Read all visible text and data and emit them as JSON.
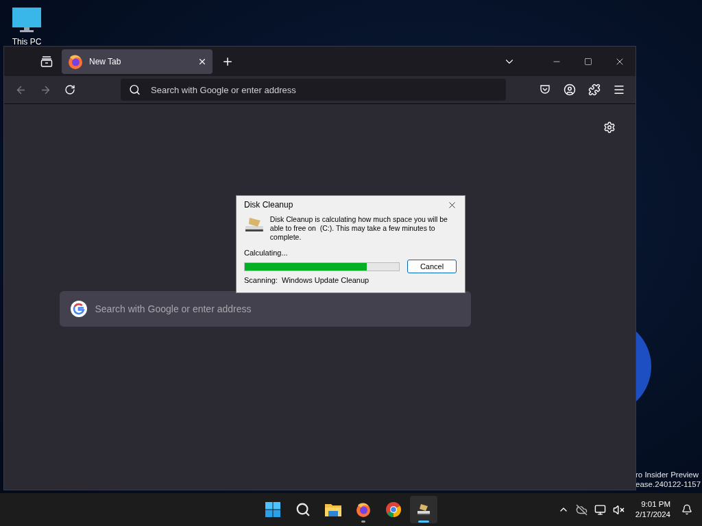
{
  "desktop": {
    "icons": [
      {
        "label": "This PC"
      }
    ],
    "watermark": [
      "ro Insider Preview",
      "ease.240122-1157"
    ]
  },
  "browser": {
    "tabs": [
      {
        "label": "New Tab",
        "selected": true
      }
    ],
    "address_bar": {
      "placeholder": "Search with Google or enter address"
    },
    "content_search": {
      "placeholder": "Search with Google or enter address"
    }
  },
  "dialog": {
    "title": "Disk Cleanup",
    "message": "Disk Cleanup is calculating how much space you will be able to free on  (C:). This may take a few minutes to complete.",
    "status": "Calculating...",
    "progress": {
      "level": 0.79
    },
    "button": "Cancel",
    "scanning_label": "Scanning:",
    "scanning_item": "Windows Update Cleanup"
  },
  "taskbar": {
    "apps": [
      {
        "kind": "start",
        "running": false,
        "selected": false
      },
      {
        "kind": "search",
        "running": false,
        "selected": false
      },
      {
        "kind": "explorer",
        "running": false,
        "selected": false
      },
      {
        "kind": "firefox",
        "running": true,
        "selected": false
      },
      {
        "kind": "chrome",
        "running": false,
        "selected": false
      },
      {
        "kind": "cleanup",
        "running": true,
        "selected": true
      }
    ],
    "time": "9:01 PM",
    "date": "2/17/2024"
  }
}
